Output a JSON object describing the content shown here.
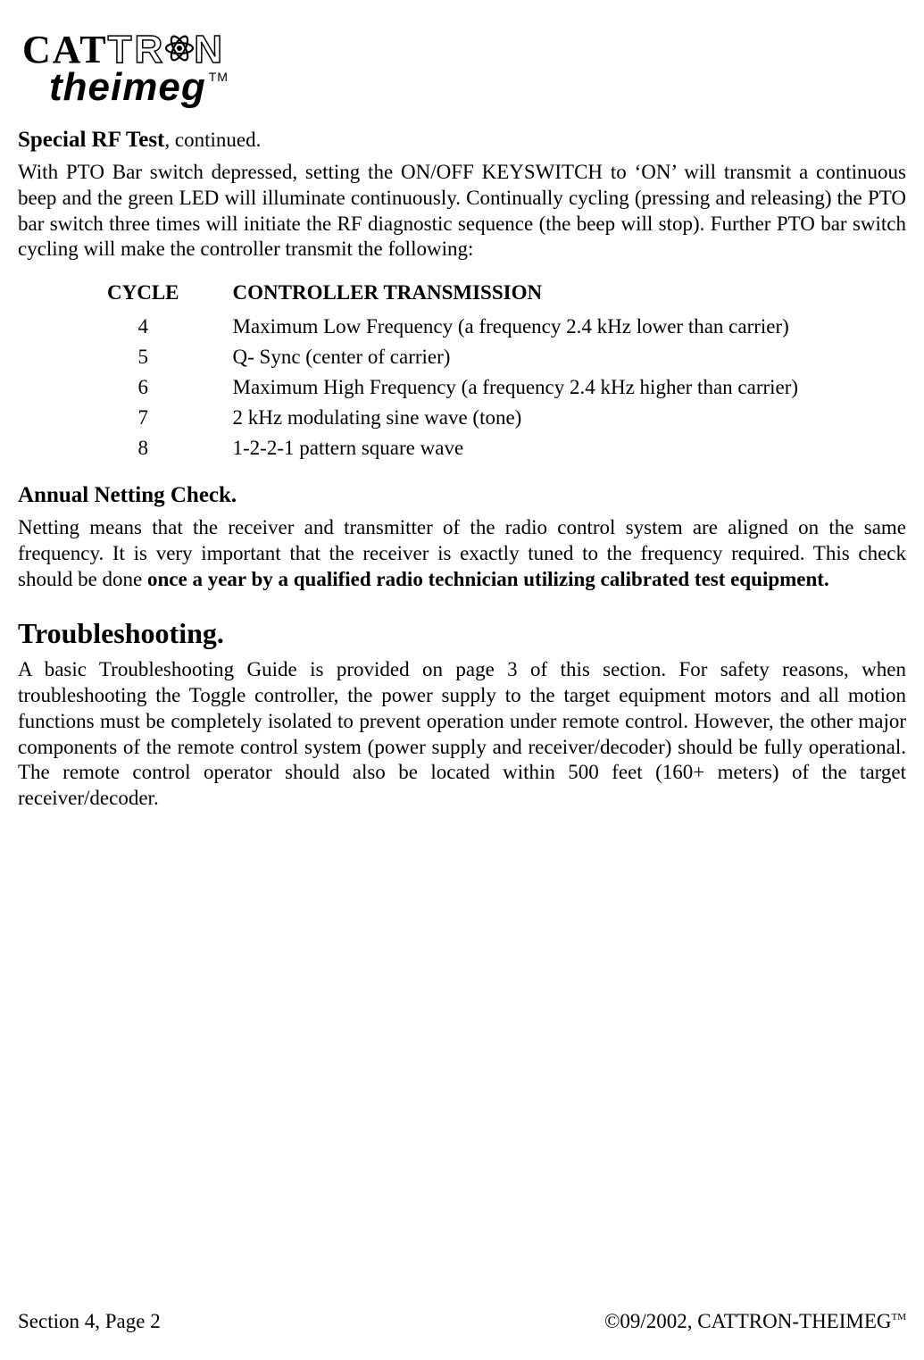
{
  "logo": {
    "line1_a": "CAT",
    "line1_b": "TR",
    "line1_c": "N",
    "line2": "theimeg",
    "tm": "TM"
  },
  "special_rf": {
    "heading_bold": "Special RF Test",
    "heading_cont": ", continued.",
    "intro": "With PTO Bar switch depressed, setting the ON/OFF KEYSWITCH to ‘ON’ will transmit a continuous beep and the green LED will illuminate continuously.  Continually cycling (pressing and releasing) the PTO bar switch three times will initiate the RF diagnostic sequence (the beep will stop).  Further PTO bar switch cycling will make the controller transmit the following:",
    "table": {
      "col1": "CYCLE",
      "col2": "CONTROLLER TRANSMISSION",
      "rows": [
        {
          "cycle": "4",
          "tx": "Maximum Low Frequency (a frequency 2.4 kHz lower than carrier)"
        },
        {
          "cycle": "5",
          "tx": "Q- Sync (center of carrier)"
        },
        {
          "cycle": "6",
          "tx": "Maximum High Frequency (a frequency 2.4 kHz higher than carrier)"
        },
        {
          "cycle": "7",
          "tx": "2 kHz modulating sine wave (tone)"
        },
        {
          "cycle": "8",
          "tx": "1-2-2-1 pattern square wave"
        }
      ]
    }
  },
  "netting": {
    "heading": "Annual Netting Check.",
    "body_pre": "Netting means that the receiver and transmitter of the radio control system are aligned on the same frequency.  It is very important that the receiver is exactly tuned to the frequency required. This check should be done ",
    "body_bold": "once a year by a qualified radio technician utilizing calibrated test equipment."
  },
  "troubleshooting": {
    "heading": "Troubleshooting.",
    "body": "A basic Troubleshooting Guide is provided on page 3 of this section.  For safety reasons, when troubleshooting the Toggle controller, the power supply to the target equipment motors and all motion functions must be completely isolated to prevent operation under remote control.  However, the other major components of the remote control system (power supply and receiver/decoder) should be fully operational.  The remote control operator should also be located within 500 feet (160+ meters) of the target receiver/decoder."
  },
  "footer": {
    "left": "Section 4, Page 2",
    "right": "©09/2002, CATTRON-THEIMEG",
    "tm": "TM"
  }
}
